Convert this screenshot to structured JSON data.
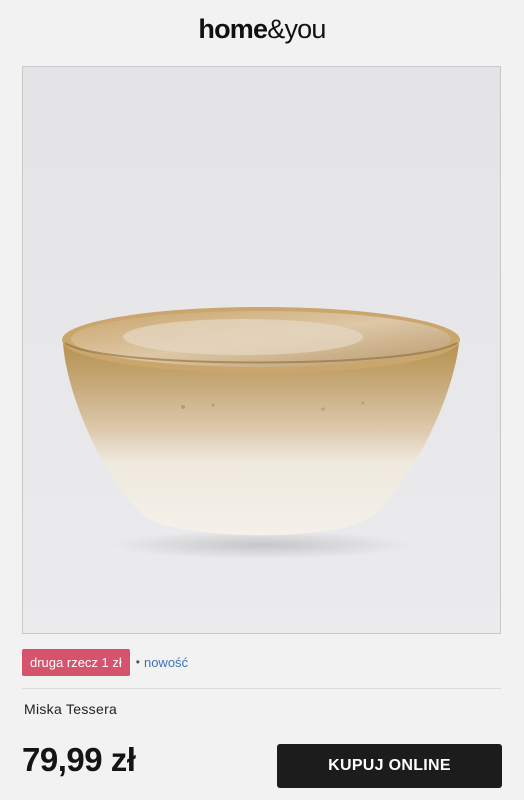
{
  "header": {
    "logo_bold": "home",
    "logo_amp": "&",
    "logo_light": "you"
  },
  "product": {
    "image_name": "bowl-image",
    "promo_badge": "druga rzecz 1 zł",
    "separator": "•",
    "new_tag": "nowość",
    "name": "Miska Tessera",
    "price": "79,99 zł",
    "buy_label": "KUPUJ ONLINE"
  },
  "colors": {
    "promo_badge_bg": "#d6536d",
    "new_tag": "#3d72b8",
    "button_bg": "#1c1c1c",
    "background": "#f2f2f2"
  }
}
